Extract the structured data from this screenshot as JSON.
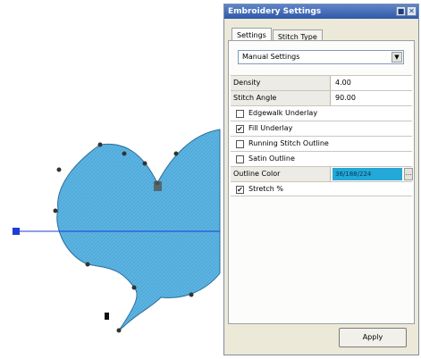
{
  "window": {
    "title": "Embroidery Settings",
    "minimize_glyph": "■",
    "close_glyph": "✕"
  },
  "tabs": [
    {
      "label": "Settings",
      "active": true
    },
    {
      "label": "Stitch Type",
      "active": false
    }
  ],
  "preset": {
    "selected": "Manual Settings",
    "arrow": "▼"
  },
  "properties": {
    "density": {
      "label": "Density",
      "value": "4.00"
    },
    "stitch_angle": {
      "label": "Stitch Angle",
      "value": "90.00"
    },
    "edgewalk_underlay": {
      "label": "Edgewalk Underlay",
      "checked": false
    },
    "fill_underlay": {
      "label": "Fill Underlay",
      "checked": true
    },
    "running_stitch_outline": {
      "label": "Running Stitch Outline",
      "checked": false
    },
    "satin_outline": {
      "label": "Satin Outline",
      "checked": false
    },
    "outline_color": {
      "label": "Outline Color",
      "value": "36/188/224",
      "color": "#23a8d8",
      "browse": "..."
    },
    "stretch": {
      "label": "Stretch %",
      "checked": true
    }
  },
  "check_mark": "✔",
  "apply_label": "Apply",
  "canvas": {
    "shape": "heart",
    "fill_color": "#5ab4e2",
    "guide_color": "#1e3cd8"
  }
}
